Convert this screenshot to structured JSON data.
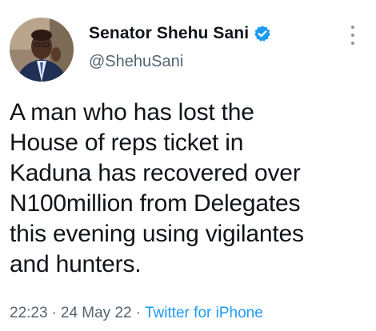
{
  "author": {
    "display_name": "Senator Shehu Sani",
    "handle": "@ShehuSani",
    "verified": true,
    "avatar_icon": "profile-photo",
    "verified_color": "#1d9bf0"
  },
  "tweet": {
    "text": "A man who has lost the\nHouse of reps ticket in\nKaduna has recovered over\nN100million from Delegates\nthis evening using vigilantes\nand hunters.",
    "time": "22:23",
    "date": "24 May 22",
    "source": "Twitter for iPhone",
    "separator": "·"
  },
  "menu": {
    "icon": "more-vertical-icon"
  }
}
